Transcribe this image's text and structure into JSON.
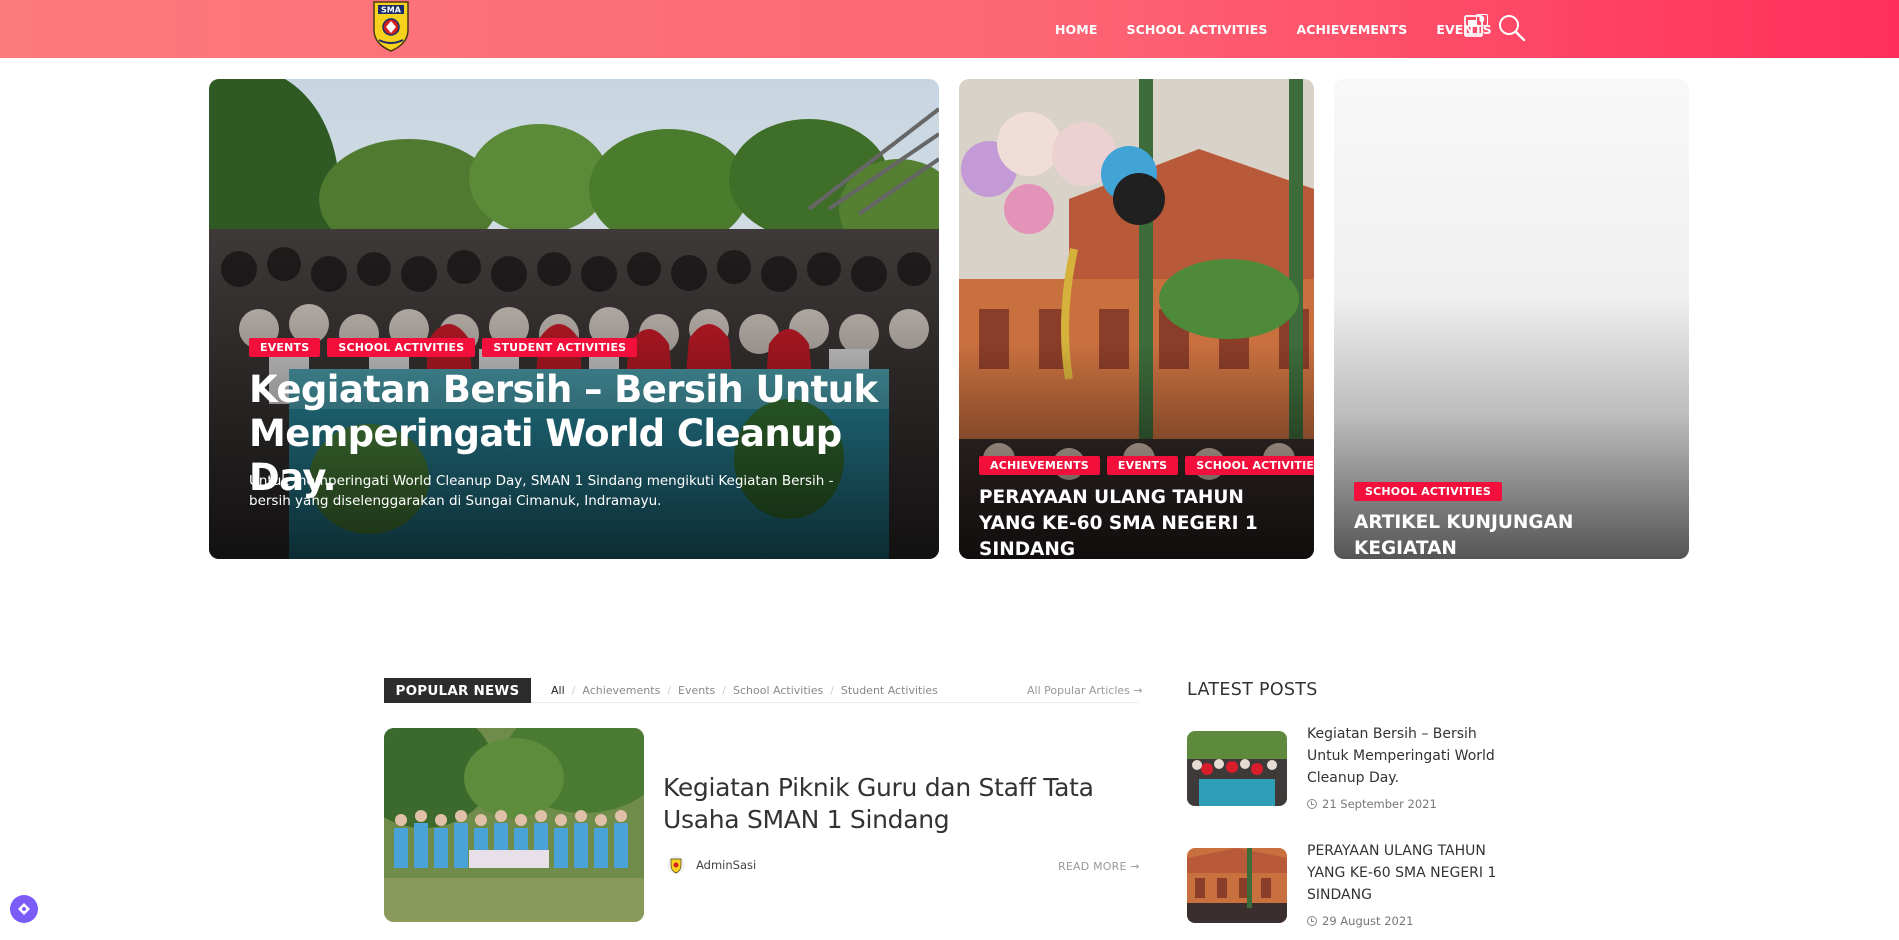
{
  "header": {
    "logo_text": "SMA",
    "nav": [
      "HOME",
      "SCHOOL ACTIVITIES",
      "ACHIEVEMENTS",
      "EVENTS"
    ],
    "cart_count": "0",
    "accent_color": "#fd6675"
  },
  "hero": {
    "main": {
      "tags": [
        "EVENTS",
        "SCHOOL ACTIVITIES",
        "STUDENT ACTIVITIES"
      ],
      "title": "Kegiatan Bersih – Bersih Untuk Memperingati World Cleanup Day.",
      "description": "Untuk memperingati World Cleanup Day, SMAN 1 Sindang mengikuti Kegiatan Bersih - bersih yang diselenggarakan di Sungai Cimanuk, Indramayu."
    },
    "second": {
      "tags": [
        "ACHIEVEMENTS",
        "EVENTS",
        "SCHOOL ACTIVITIES"
      ],
      "title": "PERAYAAN ULANG TAHUN YANG KE-60 SMA NEGERI 1 SINDANG"
    },
    "third": {
      "tags": [
        "SCHOOL ACTIVITIES"
      ],
      "title": "ARTIKEL KUNJUNGAN KEGIATAN"
    },
    "tag_color": "#f20f3b"
  },
  "popular": {
    "label": "POPULAR NEWS",
    "filters": [
      "All",
      "Achievements",
      "Events",
      "School Activities",
      "Student Activities"
    ],
    "all_link": "All Popular Articles",
    "article": {
      "title": "Kegiatan Piknik Guru dan Staff Tata Usaha SMAN 1 Sindang",
      "author": "AdminSasi",
      "read_more": "READ MORE"
    }
  },
  "latest": {
    "title": "LATEST POSTS",
    "posts": [
      {
        "title": "Kegiatan Bersih – Bersih Untuk Memperingati World Cleanup Day.",
        "date": "21 September 2021"
      },
      {
        "title": "PERAYAAN ULANG TAHUN YANG KE-60 SMA NEGERI 1 SINDANG",
        "date": "29 August 2021"
      }
    ]
  }
}
